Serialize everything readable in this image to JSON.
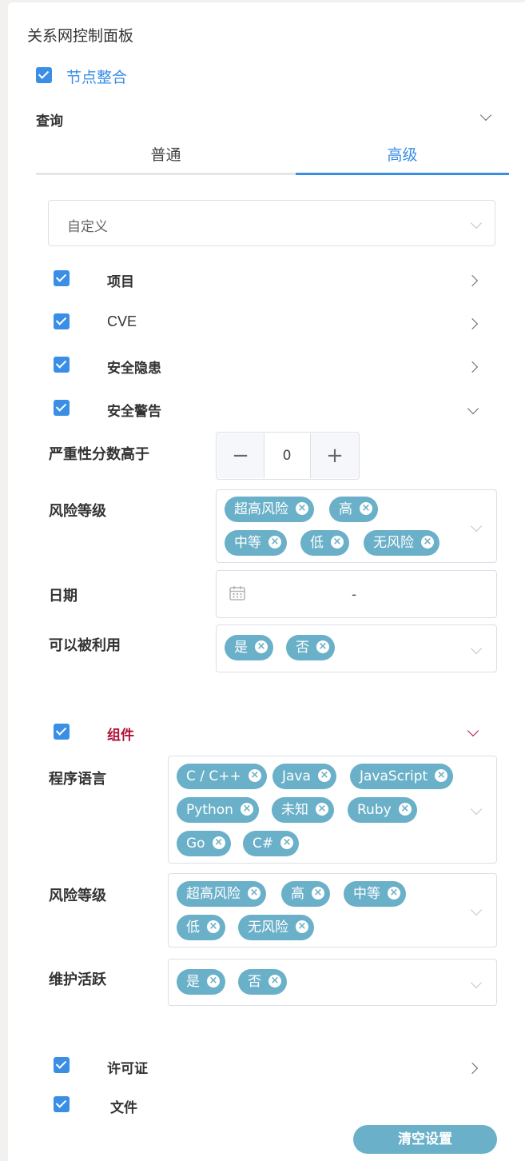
{
  "panel": {
    "title": "关系网控制面板"
  },
  "merge": {
    "label": "节点整合",
    "checked": true
  },
  "query": {
    "label": "查询",
    "tabs": [
      {
        "label": "普通"
      },
      {
        "label": "高级"
      }
    ],
    "active_tab": "高级",
    "mode_select": {
      "value": "自定义"
    }
  },
  "sections": {
    "project": {
      "label": "项目",
      "checked": true
    },
    "cve": {
      "label": "CVE",
      "checked": true
    },
    "hazard": {
      "label": "安全隐患",
      "checked": true
    },
    "alert": {
      "label": "安全警告",
      "checked": true,
      "severity": {
        "label": "严重性分数高于",
        "value": "0",
        "minus": "−",
        "plus": "+"
      },
      "risk": {
        "label": "风险等级",
        "tags": [
          "超高风险",
          "高",
          "中等",
          "低",
          "无风险"
        ]
      },
      "date": {
        "label": "日期",
        "separator": "-"
      },
      "exploitable": {
        "label": "可以被利用",
        "tags": [
          "是",
          "否"
        ]
      }
    },
    "component": {
      "label": "组件",
      "checked": true,
      "accent_color": "#b0133a",
      "language": {
        "label": "程序语言",
        "tags": [
          "C / C++",
          "Java",
          "JavaScript",
          "Python",
          "未知",
          "Ruby",
          "Go",
          "C#"
        ]
      },
      "risk": {
        "label": "风险等级",
        "tags": [
          "超高风险",
          "高",
          "中等",
          "低",
          "无风险"
        ]
      },
      "maintained": {
        "label": "维护活跃",
        "tags": [
          "是",
          "否"
        ]
      }
    },
    "license": {
      "label": "许可证",
      "checked": true
    },
    "file": {
      "label": "文件",
      "checked": true
    }
  },
  "actions": {
    "clear_label": "清空设置"
  },
  "colors": {
    "primary": "#3a8ee6",
    "tag": "#6ab0c8",
    "accent": "#b0133a"
  }
}
